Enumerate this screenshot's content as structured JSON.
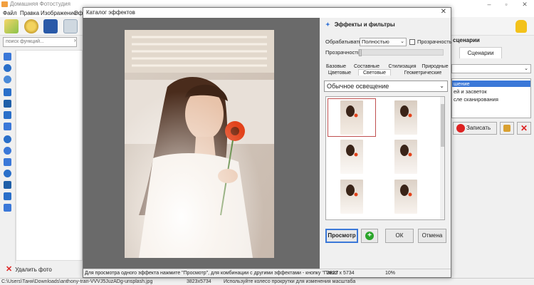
{
  "app": {
    "title": "Домашняя Фотостудия",
    "menu": [
      "Файл",
      "Правка",
      "Изображение",
      "Эф"
    ],
    "search_placeholder": "поиск функций...",
    "delete_photo": "Удалить фото",
    "status": {
      "path": "C:\\Users\\Таня\\Downloads\\anthony-tran-VVVJ5JuzADg-unsplash.jpg",
      "size": "3823x5734",
      "hint": "Используйте колесо прокрутки для изменения масштаба"
    },
    "right_panel": {
      "title": "сценарии",
      "tab": "Сценарии",
      "list": [
        "шение",
        "ей и засветок",
        "сле сканирования"
      ],
      "record": "Записать"
    }
  },
  "dialog": {
    "title": "Каталог эффектов",
    "close": "✕",
    "panel_title": "Эффекты и фильтры",
    "process_label": "Обрабатывать",
    "process_value": "Полностью",
    "transparency_check": "Прозрачность",
    "transparency_label": "Прозрачность",
    "tabs_row1": [
      "Базовые",
      "Составные",
      "Стилизация",
      "Природные"
    ],
    "tabs_row2": [
      "Цветовые",
      "Световые",
      "Геометрические"
    ],
    "effect_selected": "Обычное освещение",
    "buttons": {
      "preview": "Просмотр",
      "ok": "ОК",
      "cancel": "Отмена"
    },
    "status_hint": "Для просмотра одного эффекта нажмите \"Просмотр\", для комбинации с другими эффектами - кнопку \"Плюс\"",
    "status_size": "3823 x 5734",
    "status_zoom": "10%"
  },
  "colors": {
    "accent": "#3b78d8",
    "record_dot": "#dd2222",
    "plus_green": "#2aa52a"
  }
}
